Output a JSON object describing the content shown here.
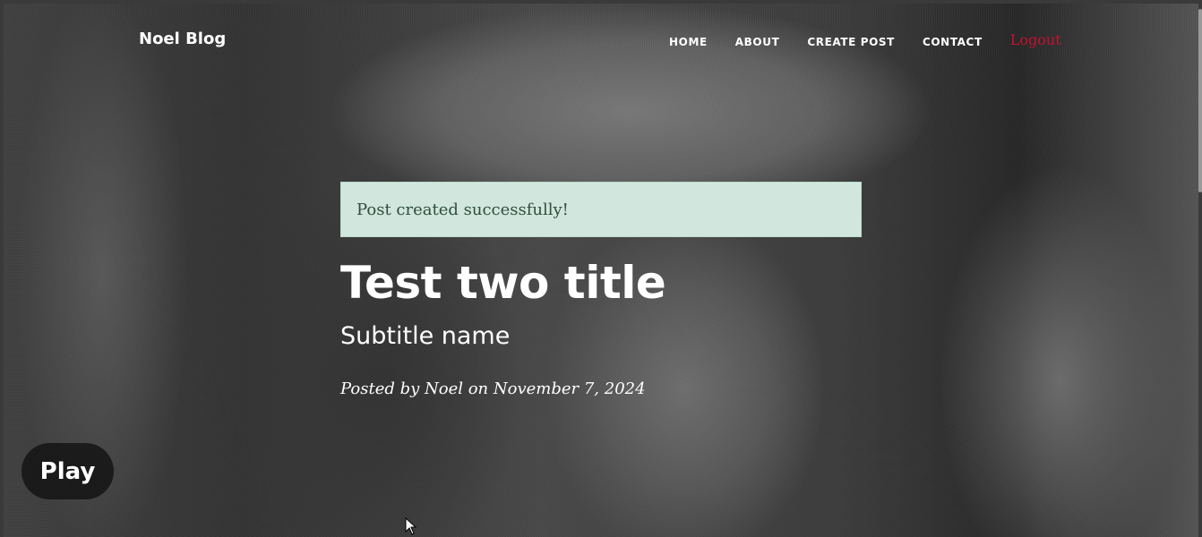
{
  "navbar": {
    "brand": "Noel Blog",
    "links": [
      {
        "label": "HOME"
      },
      {
        "label": "ABOUT"
      },
      {
        "label": "CREATE POST"
      },
      {
        "label": "CONTACT"
      }
    ],
    "logout_label": "Logout",
    "logout_color": "#c8102e"
  },
  "alert": {
    "message": "Post created successfully!",
    "background_color": "#d1e7dd"
  },
  "post": {
    "title": "Test two title",
    "subtitle": "Subtitle name",
    "meta": "Posted by Noel on November 7, 2024"
  },
  "player": {
    "play_label": "Play"
  }
}
